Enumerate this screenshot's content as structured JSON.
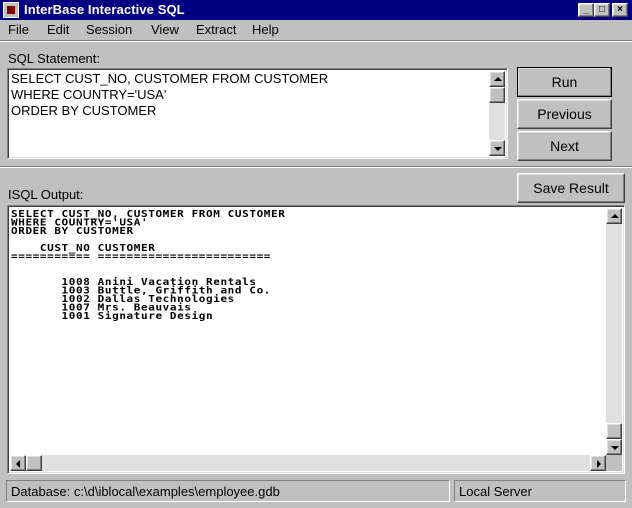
{
  "window": {
    "title": "InterBase Interactive SQL"
  },
  "menu": [
    {
      "label": "File"
    },
    {
      "label": "Edit"
    },
    {
      "label": "Session"
    },
    {
      "label": "View"
    },
    {
      "label": "Extract"
    },
    {
      "label": "Help"
    }
  ],
  "sql_statement": {
    "label": "SQL Statement:",
    "lines": [
      "SELECT CUST_NO, CUSTOMER FROM CUSTOMER",
      "WHERE COUNTRY='USA'",
      "ORDER BY CUSTOMER"
    ]
  },
  "buttons": {
    "run": "Run",
    "previous": "Previous",
    "next": "Next",
    "save_result": "Save Result"
  },
  "output": {
    "label": "ISQL Output:",
    "lines": [
      "SELECT CUST_NO, CUSTOMER FROM CUSTOMER",
      "WHERE COUNTRY='USA'",
      "ORDER BY CUSTOMER",
      "",
      "    CUST_NO CUSTOMER",
      "=========== ========================",
      "",
      "",
      "       1008 Anini Vacation Rentals",
      "       1003 Buttle, Griffith and Co.",
      "       1002 Dallas Technologies",
      "       1007 Mrs. Beauvais",
      "       1001 Signature Design"
    ]
  },
  "status": {
    "database": "Database:  c:\\d\\iblocal\\examples\\employee.gdb",
    "server": "Local Server"
  },
  "titlebar_buttons": [
    "_",
    "□",
    "×"
  ]
}
